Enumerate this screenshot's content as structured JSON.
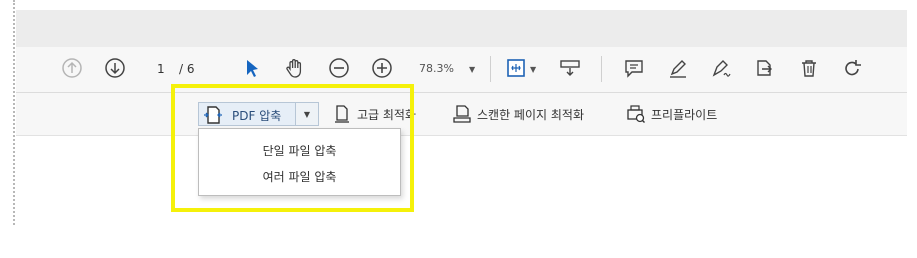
{
  "toolbar": {
    "page_current": "1",
    "page_total": "/ 6",
    "zoom": "78.3%",
    "icons": [
      "arrow-up-circle-icon",
      "arrow-down-circle-icon",
      "pointer-icon",
      "hand-icon",
      "zoom-out-icon",
      "zoom-in-icon",
      "fit-page-icon",
      "scroll-icon",
      "comment-icon",
      "highlight-icon",
      "sign-icon",
      "share-icon",
      "trash-icon",
      "rotate-icon"
    ]
  },
  "subtoolbar": {
    "compress_label": "PDF 압축",
    "advanced_opt_label": "고급 최적화",
    "scan_opt_label": "스캔한 페이지 최적화",
    "preflight_label": "프리플라이트"
  },
  "dropdown": {
    "items": [
      "단일 파일 압축",
      "여러 파일 압축"
    ]
  },
  "colors": {
    "highlight": "#f5f10a",
    "pointer": "#1565c0"
  }
}
